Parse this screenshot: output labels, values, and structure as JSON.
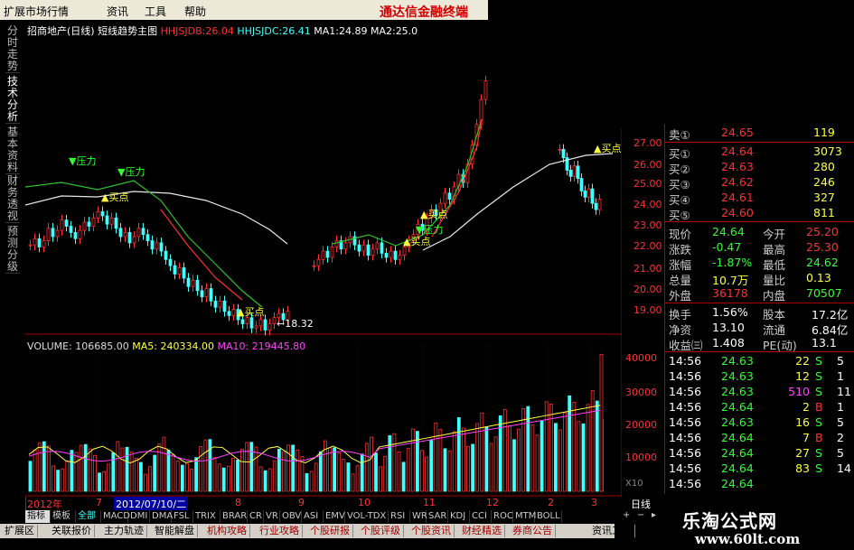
{
  "menubar": {
    "items": [
      "扩展市场行情",
      "资讯",
      "工具",
      "帮助"
    ],
    "brand": "通达信金融终端"
  },
  "left_tabs": [
    {
      "label": "分时走势",
      "active": false
    },
    {
      "label": "技术分析",
      "active": true
    },
    {
      "label": "基本资料",
      "active": false
    },
    {
      "label": "财务透视",
      "active": false
    },
    {
      "label": "预测分级",
      "active": false
    }
  ],
  "chart_header": {
    "stock": "招商地产(日线)",
    "mode": "短线趋势主图",
    "hhjsjdb_label": "HHJSJDB:",
    "hhjsjdb_value": "26.04",
    "hhjsjdc_label": "HHJSJDC:",
    "hhjsjdc_value": "26.41",
    "ma1_label": "MA1:",
    "ma1_value": "24.89",
    "ma2_label": "MA2:",
    "ma2_value": "25.0"
  },
  "volume_header": {
    "volume": "VOLUME: 106685.00",
    "ma5": "MA5: 240334.00",
    "ma10": "MA10: 219445.80"
  },
  "annotations": {
    "pressure": "▼压力",
    "buy": "▲买点",
    "low": "←18.32"
  },
  "price_axis": [
    "27.00",
    "26.00",
    "25.00",
    "24.00",
    "23.00",
    "22.00",
    "21.00",
    "20.00",
    "19.00"
  ],
  "volume_axis": [
    "40000",
    "30000",
    "20000",
    "10000"
  ],
  "volume_unit": "X10",
  "date_bar": {
    "year": "2012年",
    "date": "2012/07/10/二",
    "months": [
      "7",
      "8",
      "9",
      "10",
      "11",
      "12",
      "2",
      "3"
    ]
  },
  "period_label": "日线",
  "quotes": {
    "sells": [
      {
        "label": "卖①",
        "price": "24.65",
        "vol": "119"
      }
    ],
    "buys": [
      {
        "label": "买①",
        "price": "24.64",
        "vol": "3073"
      },
      {
        "label": "买②",
        "price": "24.63",
        "vol": "280"
      },
      {
        "label": "买③",
        "price": "24.62",
        "vol": "246"
      },
      {
        "label": "买④",
        "price": "24.61",
        "vol": "327"
      },
      {
        "label": "买⑤",
        "price": "24.60",
        "vol": "811"
      }
    ],
    "stats": [
      {
        "l1": "现价",
        "v1": "24.64",
        "l2": "今开",
        "v2": "25.20"
      },
      {
        "l1": "涨跌",
        "v1": "-0.47",
        "l2": "最高",
        "v2": "25.30"
      },
      {
        "l1": "涨幅",
        "v1": "-1.87%",
        "l2": "最低",
        "v2": "24.62"
      },
      {
        "l1": "总量",
        "v1": "10.7万",
        "l2": "量比",
        "v2": "0.13"
      },
      {
        "l1": "外盘",
        "v1": "36178",
        "l2": "内盘",
        "v2": "70507"
      }
    ],
    "stats2": [
      {
        "l1": "换手",
        "v1": "1.56%",
        "l2": "股本",
        "v2": "17.2亿"
      },
      {
        "l1": "净资",
        "v1": "13.10",
        "l2": "流通",
        "v2": "6.84亿"
      },
      {
        "l1": "收益㈢",
        "v1": "1.408",
        "l2": "PE(动)",
        "v2": "13.1"
      }
    ],
    "ticks": [
      {
        "t": "14:56",
        "p": "24.63",
        "v": "22",
        "s": "S",
        "n": "5"
      },
      {
        "t": "14:56",
        "p": "24.63",
        "v": "12",
        "s": "S",
        "n": "1"
      },
      {
        "t": "14:56",
        "p": "24.63",
        "v": "510",
        "s": "S",
        "n": "11"
      },
      {
        "t": "14:56",
        "p": "24.64",
        "v": "2",
        "s": "B",
        "n": "1"
      },
      {
        "t": "14:56",
        "p": "24.63",
        "v": "16",
        "s": "S",
        "n": "5"
      },
      {
        "t": "14:56",
        "p": "24.64",
        "v": "7",
        "s": "B",
        "n": "2"
      },
      {
        "t": "14:56",
        "p": "24.64",
        "v": "27",
        "s": "S",
        "n": "5"
      },
      {
        "t": "14:56",
        "p": "24.64",
        "v": "83",
        "s": "S",
        "n": "14"
      },
      {
        "t": "14:56",
        "p": "24.64",
        "v": "",
        "s": "",
        "n": ""
      }
    ]
  },
  "indicator_tabs": [
    "指标",
    "模板",
    "全部",
    "MACD",
    "DMI",
    "DMA",
    "FSL",
    "TRIX",
    "BRAR",
    "CR",
    "VR",
    "OBV",
    "ASI",
    "EMV",
    "VOL-TDX",
    "RSI",
    "WR",
    "SAR",
    "KDJ",
    "CCI",
    "ROC",
    "MTM",
    "BOLL"
  ],
  "bottom_tabs": [
    "扩展区",
    "关联报价",
    "主力轨迹",
    "智能解盘",
    "机构攻略",
    "行业攻略",
    "个股研报",
    "个股评级",
    "个股资讯",
    "财经精选",
    "券商公告",
    "资讯工场"
  ],
  "subtabs": [
    "+",
    "−",
    "▸"
  ],
  "watermark": {
    "line1": "乐淘公式网",
    "line2": "www.60lt.com"
  },
  "colors": {
    "up": "#ff3030",
    "down": "#40ffff",
    "yellow": "#ffff40",
    "grid": "#a00000",
    "background": "#000000"
  }
}
